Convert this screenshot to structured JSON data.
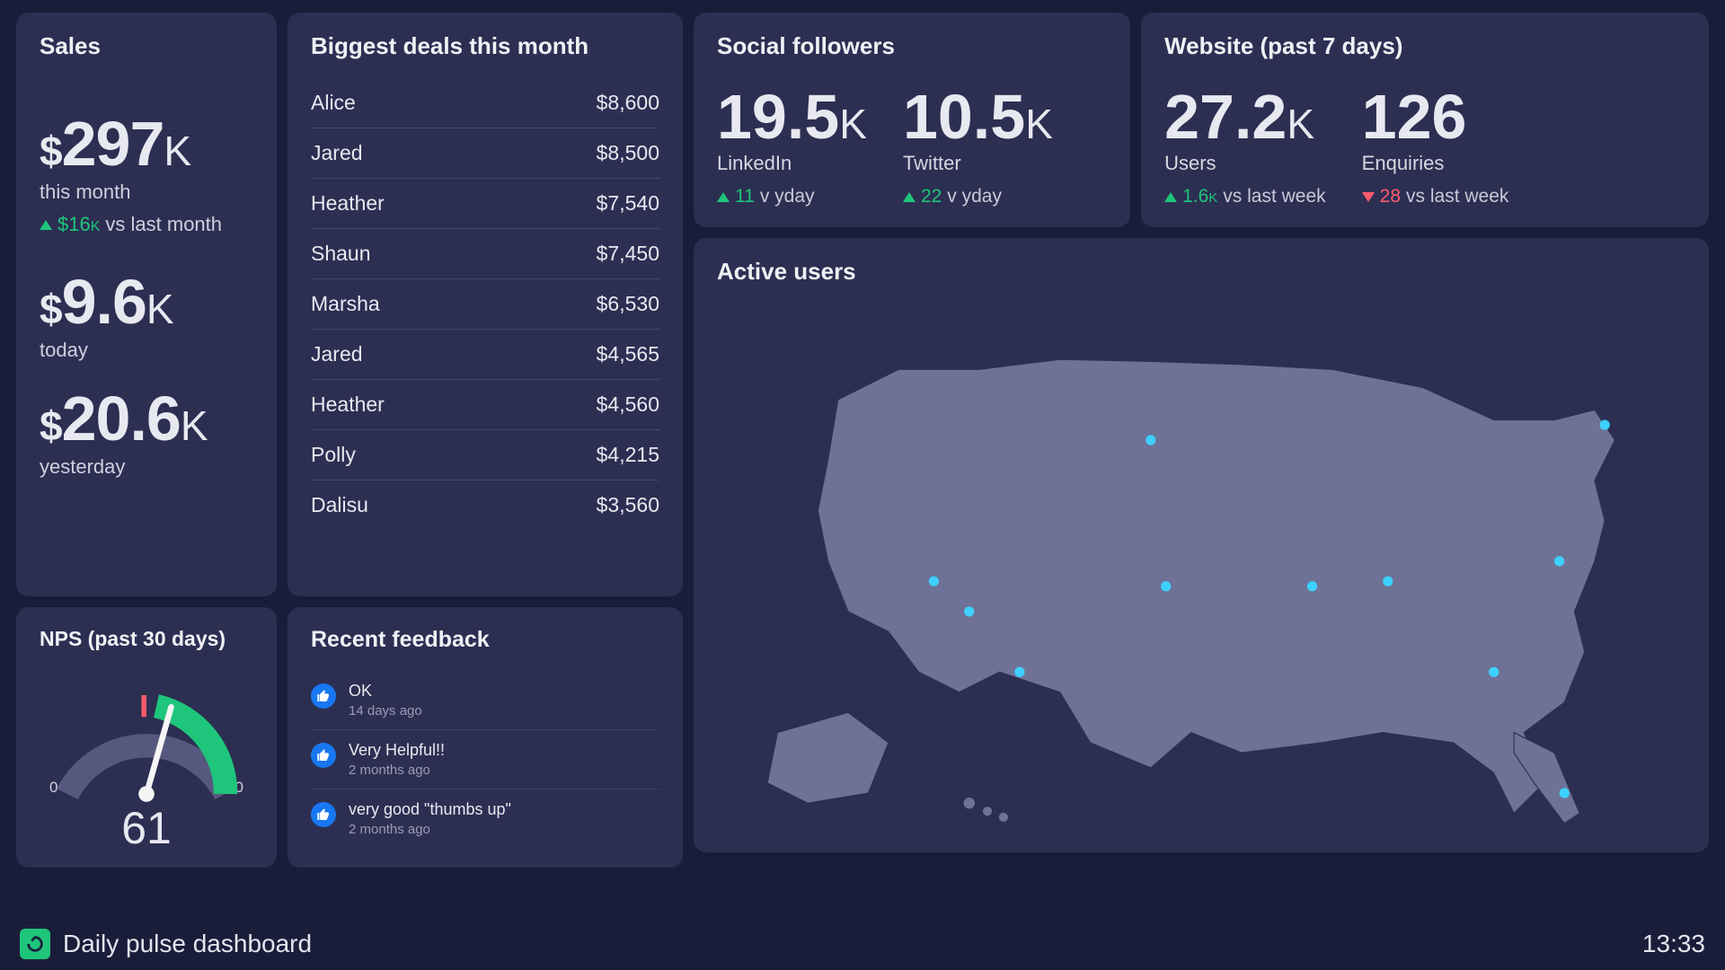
{
  "footer": {
    "title": "Daily pulse dashboard",
    "time": "13:33"
  },
  "sales": {
    "title": "Sales",
    "month": {
      "prefix": "$",
      "value": "297",
      "suffix": "k",
      "label": "this month"
    },
    "month_delta": {
      "direction": "up",
      "value_prefix": "$",
      "value": "16",
      "value_suffix": "K",
      "label": "vs last month"
    },
    "today": {
      "prefix": "$",
      "value": "9.6",
      "suffix": "k",
      "label": "today"
    },
    "yesterday": {
      "prefix": "$",
      "value": "20.6",
      "suffix": "k",
      "label": "yesterday"
    }
  },
  "deals": {
    "title": "Biggest deals this month",
    "rows": [
      {
        "name": "Alice",
        "amount": "$8,600"
      },
      {
        "name": "Jared",
        "amount": "$8,500"
      },
      {
        "name": "Heather",
        "amount": "$7,540"
      },
      {
        "name": "Shaun",
        "amount": "$7,450"
      },
      {
        "name": "Marsha",
        "amount": "$6,530"
      },
      {
        "name": "Jared",
        "amount": "$4,565"
      },
      {
        "name": "Heather",
        "amount": "$4,560"
      },
      {
        "name": "Polly",
        "amount": "$4,215"
      },
      {
        "name": "Dalisu",
        "amount": "$3,560"
      }
    ]
  },
  "social": {
    "title": "Social followers",
    "items": [
      {
        "value": "19.5",
        "suffix": "k",
        "label": "LinkedIn",
        "delta_dir": "up",
        "delta_val": "11",
        "delta_label": "v yday"
      },
      {
        "value": "10.5",
        "suffix": "k",
        "label": "Twitter",
        "delta_dir": "up",
        "delta_val": "22",
        "delta_label": "v yday"
      }
    ]
  },
  "website": {
    "title": "Website (past 7 days)",
    "items": [
      {
        "value": "27.2",
        "suffix": "k",
        "label": "Users",
        "delta_dir": "up",
        "delta_val": "1.6",
        "delta_suffix": "K",
        "delta_label": "vs last week"
      },
      {
        "value": "126",
        "suffix": "",
        "label": "Enquiries",
        "delta_dir": "down",
        "delta_val": "28",
        "delta_suffix": "",
        "delta_label": "vs last week"
      }
    ]
  },
  "map": {
    "title": "Active users"
  },
  "nps": {
    "title": "NPS (past 30 days)",
    "min": "0",
    "max": "100",
    "value": "61"
  },
  "feedback": {
    "title": "Recent feedback",
    "items": [
      {
        "text": "OK",
        "time": "14 days ago"
      },
      {
        "text": "Very Helpful!!",
        "time": "2 months ago"
      },
      {
        "text": "very good \"thumbs up\"",
        "time": "2 months ago"
      }
    ]
  }
}
